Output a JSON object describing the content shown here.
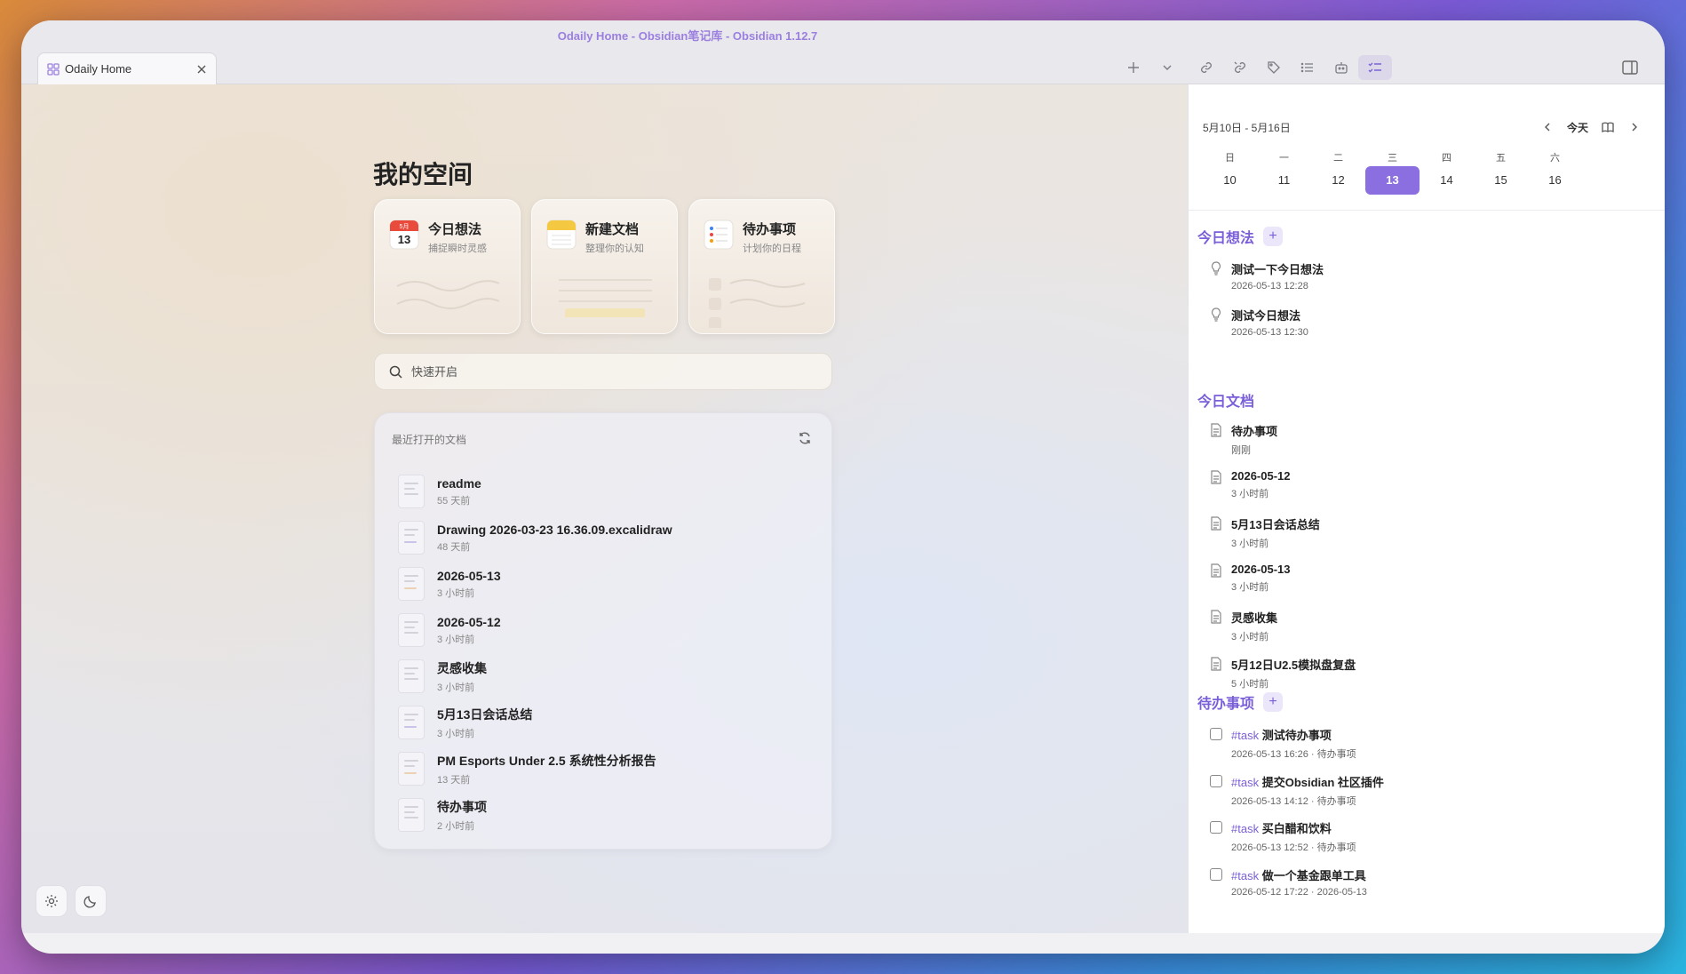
{
  "window": {
    "title": "Odaily Home - Obsidian笔记库 - Obsidian 1.12.7"
  },
  "tab": {
    "label": "Odaily Home"
  },
  "colors": {
    "accent": "#8b6ee0",
    "accent_text": "#7a5fd8"
  },
  "main": {
    "title": "我的空间",
    "cards": [
      {
        "title": "今日想法",
        "subtitle": "捕捉瞬时灵感",
        "icon": "calendar-icon",
        "icon_month": "5月",
        "icon_day": "13"
      },
      {
        "title": "新建文档",
        "subtitle": "整理你的认知",
        "icon": "notes-icon"
      },
      {
        "title": "待办事项",
        "subtitle": "计划你的日程",
        "icon": "reminders-icon"
      }
    ],
    "search": {
      "placeholder": "快速开启",
      "value": ""
    },
    "recent": {
      "title": "最近打开的文档",
      "items": [
        {
          "name": "readme",
          "time": "55 天前"
        },
        {
          "name": "Drawing 2026-03-23 16.36.09.excalidraw",
          "time": "48 天前"
        },
        {
          "name": "2026-05-13",
          "time": "3 小时前"
        },
        {
          "name": "2026-05-12",
          "time": "3 小时前"
        },
        {
          "name": "灵感收集",
          "time": "3 小时前"
        },
        {
          "name": "5月13日会话总结",
          "time": "3 小时前"
        },
        {
          "name": "PM Esports Under 2.5 系统性分析报告",
          "time": "13 天前"
        },
        {
          "name": "待办事项",
          "time": "2 小时前"
        }
      ]
    }
  },
  "calendar": {
    "range": "5月10日 - 5月16日",
    "today_label": "今天",
    "weekdays": [
      "日",
      "一",
      "二",
      "三",
      "四",
      "五",
      "六"
    ],
    "days": [
      "10",
      "11",
      "12",
      "13",
      "14",
      "15",
      "16"
    ],
    "selected": "13"
  },
  "sidebar": {
    "ideas": {
      "title": "今日想法",
      "items": [
        {
          "name": "测试一下今日想法",
          "meta": "2026-05-13 12:28"
        },
        {
          "name": "测试今日想法",
          "meta": "2026-05-13 12:30"
        }
      ]
    },
    "docs": {
      "title": "今日文档",
      "items": [
        {
          "name": "待办事项",
          "meta": "刚刚"
        },
        {
          "name": "2026-05-12",
          "meta": "3 小时前"
        },
        {
          "name": "5月13日会话总结",
          "meta": "3 小时前"
        },
        {
          "name": "2026-05-13",
          "meta": "3 小时前"
        },
        {
          "name": "灵感收集",
          "meta": "3 小时前"
        },
        {
          "name": "5月12日U2.5模拟盘复盘",
          "meta": "5 小时前"
        }
      ]
    },
    "todos": {
      "title": "待办事项",
      "items": [
        {
          "tag": "#task",
          "name": "测试待办事项",
          "meta": "2026-05-13 16:26 · 待办事项"
        },
        {
          "tag": "#task",
          "name": "提交Obsidian 社区插件",
          "meta": "2026-05-13 14:12 · 待办事项"
        },
        {
          "tag": "#task",
          "name": "买白醋和饮料",
          "meta": "2026-05-13 12:52 · 待办事项"
        },
        {
          "tag": "#task",
          "name": "做一个基金跟单工具",
          "meta": "2026-05-12 17:22 · 2026-05-13"
        }
      ]
    }
  }
}
